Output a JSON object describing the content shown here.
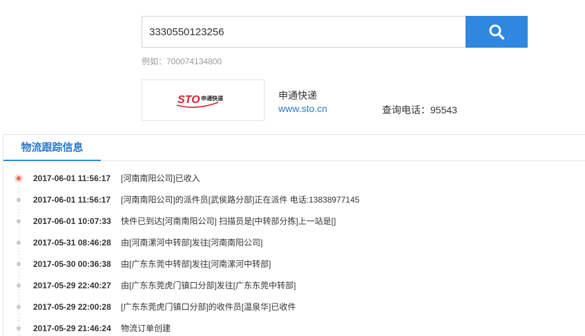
{
  "search": {
    "value": "3330550123256",
    "hint": "例如：700074134800"
  },
  "carrier": {
    "logo_text": "STO",
    "logo_subtext": "申通快递",
    "name": "申通快递",
    "website": "www.sto.cn",
    "phone": "查询电话：95543"
  },
  "tracking": {
    "title": "物流跟踪信息",
    "records": [
      {
        "time": "2017-06-01 11:56:17",
        "desc": "[河南南阳公司]已收入"
      },
      {
        "time": "2017-06-01 11:56:17",
        "desc": "[河南南阳公司]的派件员[武侯路分部]正在派件 电话:13838977145"
      },
      {
        "time": "2017-06-01 10:07:33",
        "desc": "快件已到达[河南南阳公司] 扫描员是[中转部分拣]上一站是[]"
      },
      {
        "time": "2017-05-31 08:46:28",
        "desc": "由[河南漯河中转部]发往[河南南阳公司]"
      },
      {
        "time": "2017-05-30 00:36:38",
        "desc": "由[广东东莞中转部]发往[河南漯河中转部]"
      },
      {
        "time": "2017-05-29 22:40:27",
        "desc": "由[广东东莞虎门镇口分部]发往[广东东莞中转部]"
      },
      {
        "time": "2017-05-29 22:00:28",
        "desc": "[广东东莞虎门镇口分部]的收件员[温泉华]已收件"
      },
      {
        "time": "2017-05-29 21:46:24",
        "desc": "物流订单创建"
      }
    ]
  },
  "colors": {
    "accent": "#2f87e0",
    "link": "#2b78cc",
    "current_dot": "#f06b4b",
    "logo_red": "#d9232d"
  }
}
